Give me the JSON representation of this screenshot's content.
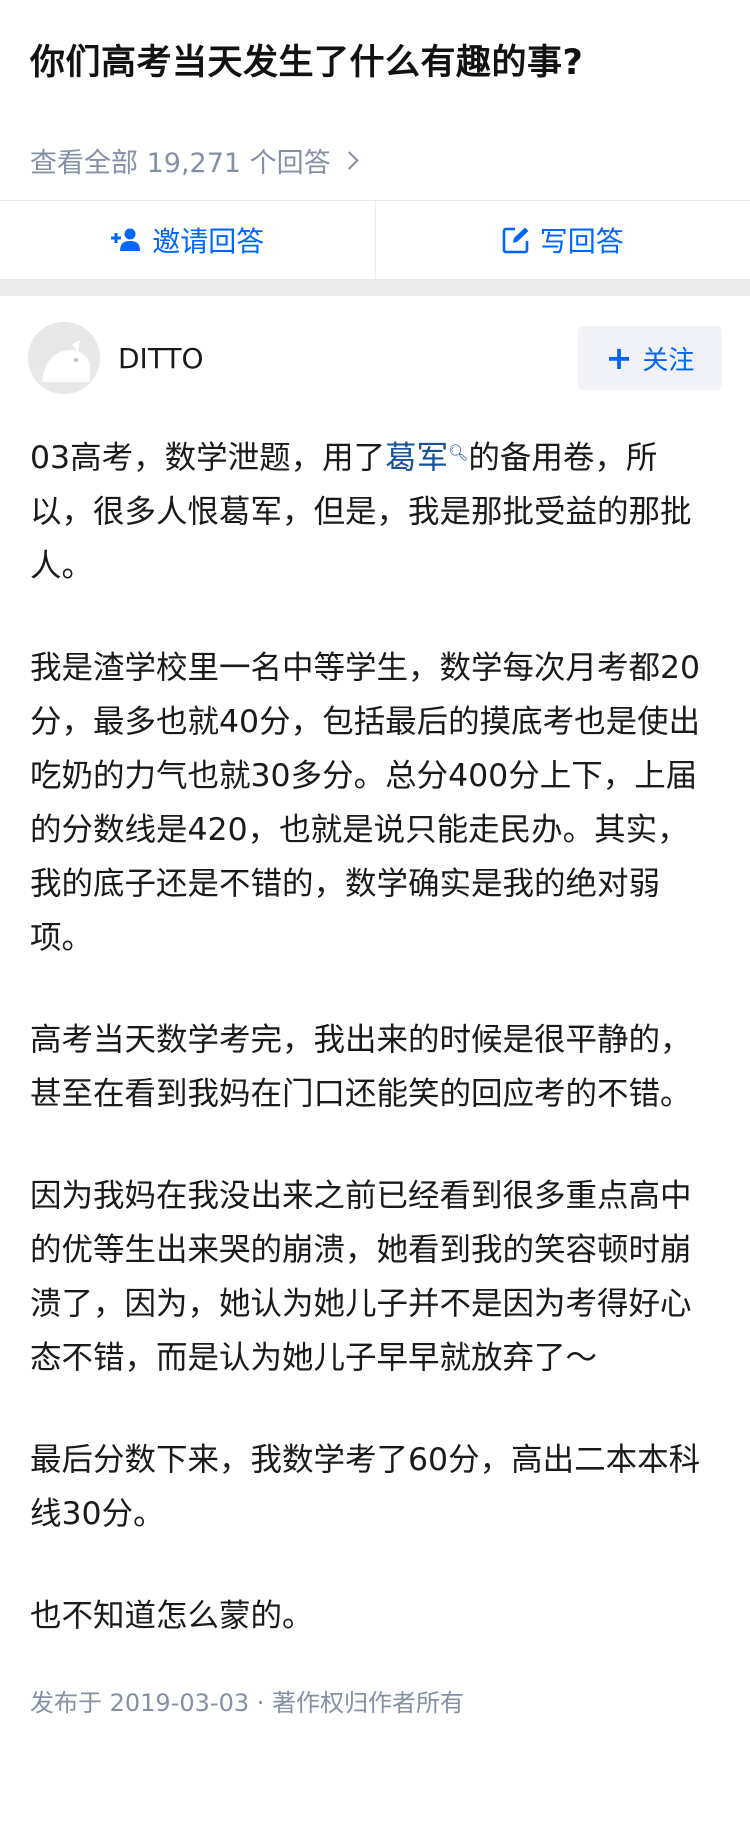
{
  "question": {
    "title": "你们高考当天发生了什么有趣的事?"
  },
  "view_all": {
    "label": "查看全部 19,271 个回答"
  },
  "actions": {
    "invite_label": "邀请回答",
    "write_label": "写回答"
  },
  "author": {
    "name": "DITTO",
    "follow_label": "关注"
  },
  "answer": {
    "p1_before": "03高考，数学泄题，用了",
    "p1_link": "葛军",
    "p1_after": "的备用卷，所以，很多人恨葛军，但是，我是那批受益的那批人。",
    "p2": "我是渣学校里一名中等学生，数学每次月考都20分，最多也就40分，包括最后的摸底考也是使出吃奶的力气也就30多分。总分400分上下，上届的分数线是420，也就是说只能走民办。其实，我的底子还是不错的，数学确实是我的绝对弱项。",
    "p3": "高考当天数学考完，我出来的时候是很平静的，甚至在看到我妈在门口还能笑的回应考的不错。",
    "p4": "因为我妈在我没出来之前已经看到很多重点高中的优等生出来哭的崩溃，她看到我的笑容顿时崩溃了，因为，她认为她儿子并不是因为考得好心态不错，而是认为她儿子早早就放弃了～",
    "p5": "最后分数下来，我数学考了60分，高出二本本科线30分。",
    "p6": "也不知道怎么蒙的。"
  },
  "meta": {
    "text": "发布于 2019-03-03 · 著作权归作者所有"
  },
  "colors": {
    "accent": "#0066ff",
    "link": "#175199",
    "muted": "#8590a6",
    "divider": "#ebebeb"
  }
}
